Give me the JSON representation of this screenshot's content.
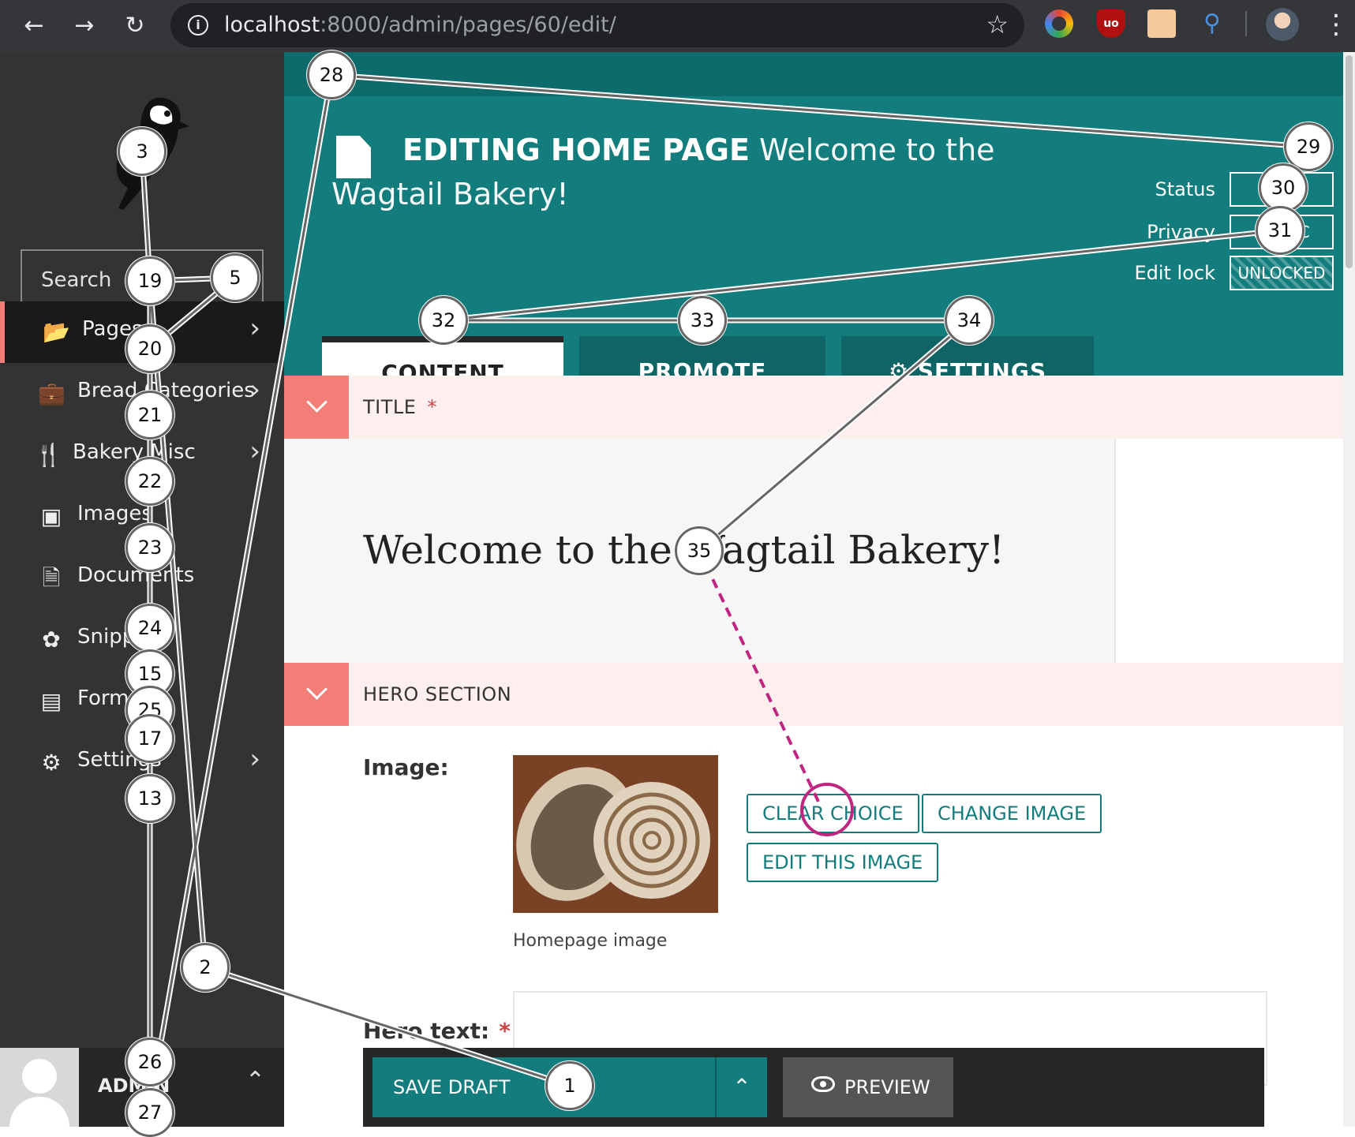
{
  "browser": {
    "url_host": "localhost",
    "url_path": ":8000/admin/pages/60/edit/",
    "extensions": [
      "color-picker-icon",
      "ublock-icon",
      "extension-face-icon",
      "search-extension-icon"
    ],
    "ublock_label": "uo"
  },
  "sidebar": {
    "search_placeholder": "Search",
    "items": [
      {
        "label": "Pages",
        "icon": "folder-open-icon",
        "has_submenu": true,
        "active": true
      },
      {
        "label": "Bread Categories",
        "icon": "suitcase-icon",
        "has_submenu": true
      },
      {
        "label": "Bakery Misc",
        "icon": "utensils-icon",
        "has_submenu": true
      },
      {
        "label": "Images",
        "icon": "image-icon",
        "has_submenu": false
      },
      {
        "label": "Documents",
        "icon": "document-icon",
        "has_submenu": false
      },
      {
        "label": "Snippets",
        "icon": "snippet-icon",
        "has_submenu": false
      },
      {
        "label": "Forms",
        "icon": "form-icon",
        "has_submenu": false
      },
      {
        "label": "Settings",
        "icon": "cogs-icon",
        "has_submenu": true
      }
    ],
    "account_name": "ADMIN"
  },
  "header": {
    "title_prefix": "EDITING HOME PAGE",
    "title_page": "Welcome to the Wagtail Bakery!",
    "status_label": "Status",
    "status_value": "LIVE",
    "privacy_label": "Privacy",
    "privacy_value": "PUBLIC",
    "lock_label": "Edit lock",
    "lock_value": "UNLOCKED"
  },
  "tabs": [
    {
      "label": "CONTENT",
      "active": true
    },
    {
      "label": "PROMOTE",
      "active": false
    },
    {
      "label": "SETTINGS",
      "active": false
    }
  ],
  "title_panel": {
    "label": "TITLE",
    "required_mark": "*",
    "value": "Welcome to the Wagtail Bakery!"
  },
  "hero_panel": {
    "label": "HERO SECTION",
    "image_label": "Image:",
    "image_caption": "Homepage image",
    "buttons": {
      "clear": "CLEAR CHOICE",
      "change": "CHANGE IMAGE",
      "edit": "EDIT THIS IMAGE"
    },
    "hero_text_label": "Hero text:",
    "required_mark": "*"
  },
  "footer": {
    "save_label": "SAVE DRAFT",
    "more_icon": "chevron-up-icon",
    "preview_label": "PREVIEW"
  },
  "annotations": [
    "1",
    "2",
    "3",
    "5",
    "19",
    "20",
    "21",
    "22",
    "23",
    "24",
    "15",
    "25",
    "17",
    "13",
    "26",
    "27",
    "28",
    "29",
    "30",
    "31",
    "32",
    "33",
    "34",
    "35"
  ],
  "colors": {
    "brand_teal": "#137c7c",
    "dark_teal": "#0e6b6b",
    "salmon": "#f37e77",
    "sidebar": "#333333",
    "annotation_pink": "#c0267f"
  }
}
